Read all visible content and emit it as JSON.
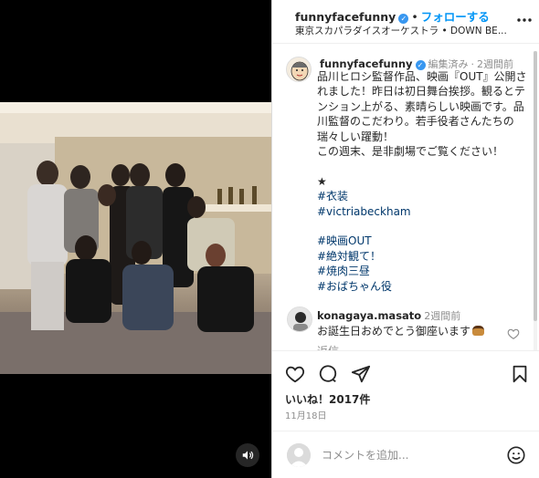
{
  "post": {
    "username": "funnyfacefunny",
    "follow_label": "フォローする",
    "music": "東京スカパラダイスオーケストラ • DOWN BE..."
  },
  "caption": {
    "username": "funnyfacefunny",
    "edited": "編集済み",
    "time": "2週間前",
    "body": "品川ヒロシ監督作品、映画『OUT』公開されました！昨日は初日舞台挨拶。観るとテンション上がる、素晴らしい映画です。品川監督のこだわり。若手役者さんたちの瑞々しい躍動！\nこの週末、是非劇場でご覧ください！\n\n★",
    "tags": [
      "#衣装",
      "#victriabeckham",
      "",
      "#映画OUT",
      "#絶対観て！",
      "#焼肉三昼",
      "#おばちゃん役"
    ]
  },
  "comment": {
    "username": "konagaya.masato",
    "time": "2週間前",
    "text": "お誕生日おめでとう御座います",
    "reply_label": "返信"
  },
  "stats": {
    "likes": "いいね！2017件",
    "date": "11月18日"
  },
  "composer": {
    "placeholder": "コメントを追加..."
  },
  "icons": {
    "like": "heart-icon",
    "comment": "comment-icon",
    "share": "share-icon",
    "save": "bookmark-icon",
    "more": "more-icon",
    "emoji": "emoji-icon",
    "sound": "speaker-icon"
  },
  "colors": {
    "link_blue": "#0095f6",
    "hashtag": "#00376b",
    "verified": "#3897f0"
  }
}
